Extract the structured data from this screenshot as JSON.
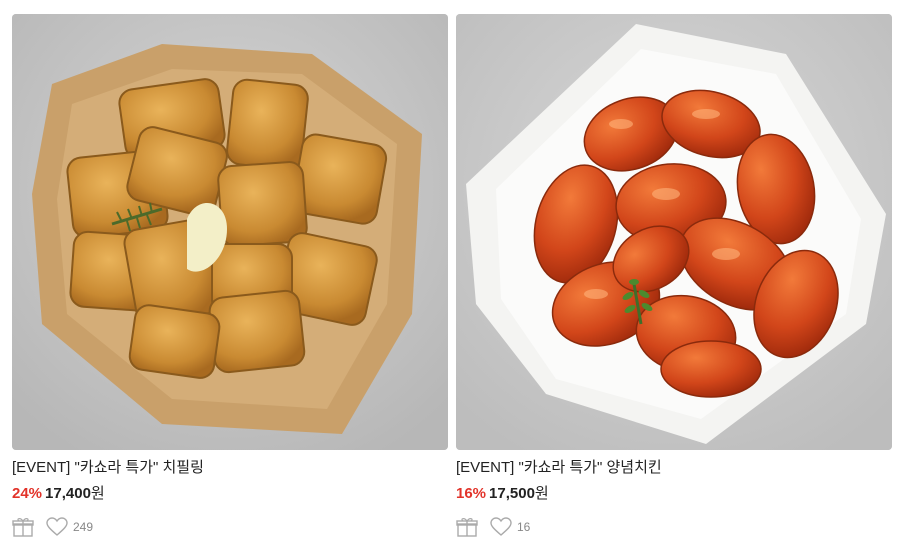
{
  "products": [
    {
      "title": "[EVENT] \"카쇼라 특가\" 치필링",
      "discount": "24%",
      "price": "17,400",
      "currency": "원",
      "likes": "249",
      "image_icon": "food-image"
    },
    {
      "title": "[EVENT] \"카쇼라 특가\" 양념치킨",
      "discount": "16%",
      "price": "17,500",
      "currency": "원",
      "likes": "16",
      "image_icon": "food-image"
    }
  ],
  "colors": {
    "discount": "#e2332a",
    "text": "#222222",
    "muted": "#888888",
    "icon": "#aaaaaa"
  },
  "icons": {
    "gift": "gift-icon",
    "like": "heart-icon"
  }
}
